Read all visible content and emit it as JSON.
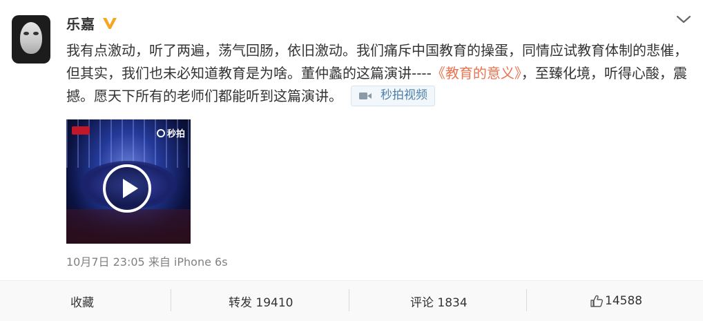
{
  "user": {
    "name": "乐嘉"
  },
  "post": {
    "text_before_link": "我有点激动，听了两遍，荡气回肠，依旧激动。我们痛斥中国教育的操蛋，同情应试教育体制的悲催，但其实，我们也未必知道教育是为啥。董仲蠡的这篇演讲----",
    "link_text": "《教育的意义》",
    "text_after_link": "，至臻化境，听得心酸，震撼。愿天下所有的老师们都能听到这篇演讲。",
    "video_tag_label": "秒拍视频",
    "thumbnail_logo_text": "秒拍",
    "timestamp": "10月7日 23:05",
    "source": "来自 iPhone 6s"
  },
  "actions": {
    "favorite_label": "收藏",
    "repost_label": "转发 19410",
    "comment_label": "评论 1834",
    "like_count": "14588"
  },
  "colors": {
    "link": "#eb7350",
    "meta": "#808080",
    "video_tag_text": "#4e7fa8",
    "verified_badge": "#f5a623"
  },
  "icons": {
    "verified": "verified-v-icon",
    "menu": "chevron-down-icon",
    "video": "video-camera-icon",
    "play": "play-icon",
    "like": "thumbs-up-icon"
  }
}
